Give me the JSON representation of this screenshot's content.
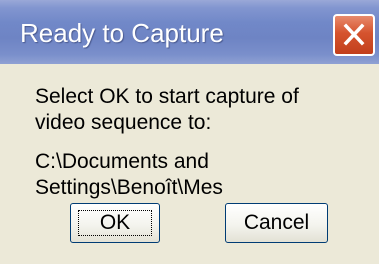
{
  "window": {
    "title": "Ready to Capture",
    "close_icon": "close-icon"
  },
  "message": {
    "line1": "Select OK to start capture of",
    "line2": "video sequence to:"
  },
  "path": {
    "line1": "C:\\Documents and",
    "line2": "Settings\\Benoît\\Mes"
  },
  "buttons": {
    "ok_label": "OK",
    "cancel_label": "Cancel"
  },
  "colors": {
    "title_bar": "#7188C8",
    "close_button": "#D5532E",
    "dialog_background": "#ECE9D8"
  }
}
